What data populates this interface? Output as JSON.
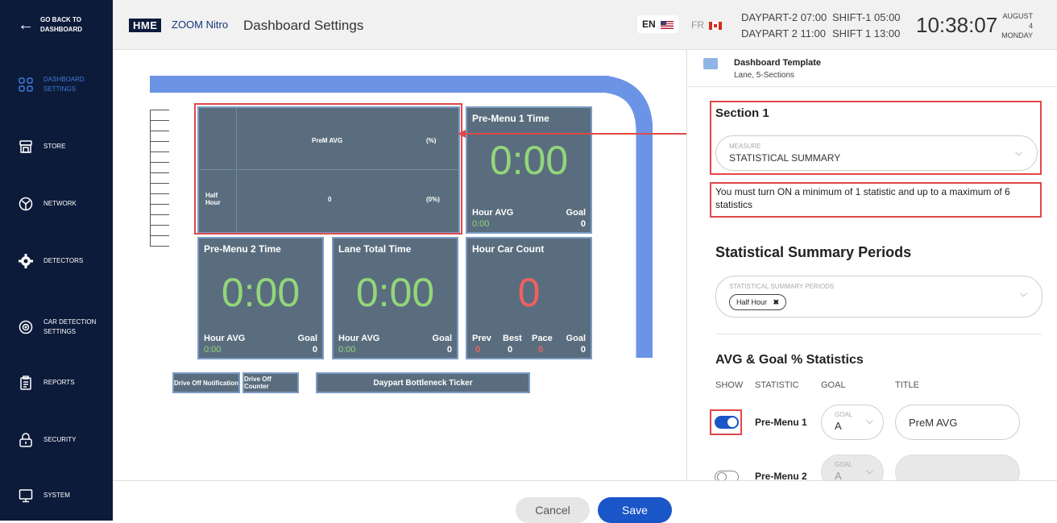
{
  "sidebar": {
    "back_label_1": "GO BACK TO",
    "back_label_2": "DASHBOARD",
    "items": [
      {
        "label_1": "DASHBOARD",
        "label_2": "SETTINGS"
      },
      {
        "label_1": "STORE",
        "label_2": ""
      },
      {
        "label_1": "NETWORK",
        "label_2": ""
      },
      {
        "label_1": "DETECTORS",
        "label_2": ""
      },
      {
        "label_1": "CAR DETECTION",
        "label_2": "SETTINGS"
      },
      {
        "label_1": "REPORTS",
        "label_2": ""
      },
      {
        "label_1": "SECURITY",
        "label_2": ""
      },
      {
        "label_1": "SYSTEM",
        "label_2": ""
      }
    ]
  },
  "header": {
    "logo_hme": "HME",
    "logo_zoom": "ZOOM Nitro",
    "title": "Dashboard Settings",
    "lang_en": "EN",
    "lang_fr": "FR",
    "daypart_1": "DAYPART-2 07:00",
    "daypart_2": "DAYPART 2 11:00",
    "shift_1": "SHIFT-1 05:00",
    "shift_2": "SHIFT 1 13:00",
    "clock": "10:38:07",
    "date_1": "AUGUST 4",
    "date_2": "MONDAY"
  },
  "preview": {
    "stat_title": "PreM AVG",
    "stat_pct": "(%)",
    "stat_period_1": "Half",
    "stat_period_2": "Hour",
    "stat_value": "0",
    "stat_value_pct": "(0%)",
    "tiles": [
      {
        "title": "Pre-Menu 1 Time",
        "value": "0:00",
        "foot_left": "Hour AVG",
        "foot_left_val": "0:00",
        "foot_right": "Goal",
        "foot_right_val": "0"
      },
      {
        "title": "Pre-Menu 2 Time",
        "value": "0:00",
        "foot_left": "Hour AVG",
        "foot_left_val": "0:00",
        "foot_right": "Goal",
        "foot_right_val": "0"
      },
      {
        "title": "Lane Total Time",
        "value": "0:00",
        "foot_left": "Hour AVG",
        "foot_left_val": "0:00",
        "foot_right": "Goal",
        "foot_right_val": "0"
      },
      {
        "title": "Hour Car Count",
        "value": "0",
        "prev": "Prev",
        "prev_val": "0",
        "best": "Best",
        "best_val": "0",
        "pace": "Pace",
        "pace_val": "0",
        "goal": "Goal",
        "goal_val": "0"
      }
    ],
    "drive_off_notification": "Drive Off Notification",
    "drive_off_counter": "Drive Off Counter",
    "bottleneck_ticker": "Daypart Bottleneck Ticker"
  },
  "panel": {
    "template_title": "Dashboard Template",
    "template_sub": "Lane, 5-Sections",
    "section_title": "Section 1",
    "measure_label": "MEASURE",
    "measure_value": "STATISTICAL SUMMARY",
    "info_text": "You must turn ON a minimum of 1 statistic and up to a maximum of 6 statistics",
    "periods_heading": "Statistical Summary Periods",
    "periods_label": "STATISTICAL SUMMARY PERIODS",
    "period_chip": "Half Hour",
    "avg_heading": "AVG & Goal % Statistics",
    "col_show": "SHOW",
    "col_statistic": "STATISTIC",
    "col_goal": "GOAL",
    "col_title": "TITLE",
    "rows": [
      {
        "statistic": "Pre-Menu 1",
        "goal_label": "GOAL",
        "goal_value": "A",
        "title": "PreM AVG",
        "on": true
      },
      {
        "statistic": "Pre-Menu 2",
        "goal_label": "GOAL",
        "goal_value": "A",
        "title": "",
        "on": false
      }
    ]
  },
  "footer": {
    "cancel": "Cancel",
    "save": "Save"
  },
  "colors": {
    "sidebar_bg": "#0d1b3a",
    "accent": "#1a56c7",
    "tile_bg": "#5a6d7e",
    "tile_value_green": "#93d67a",
    "tile_value_red": "#f06060",
    "highlight_red": "#e04848"
  }
}
